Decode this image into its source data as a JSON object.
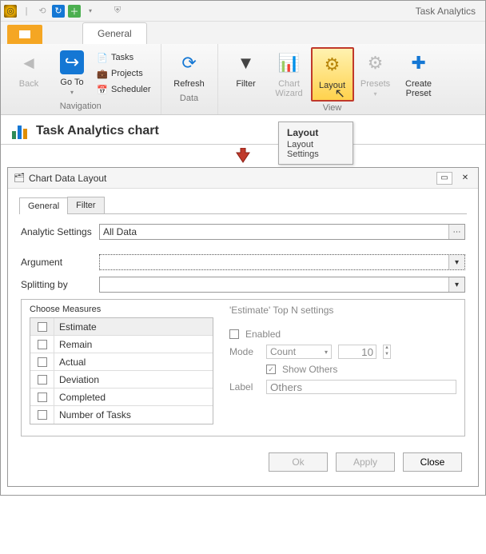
{
  "app": {
    "title": "Task Analytics"
  },
  "titlebar_icons": [
    "app",
    "sep",
    "sync",
    "plus",
    "dropdown",
    "shield"
  ],
  "ribbon_tab": "General",
  "ribbon": {
    "nav": {
      "label": "Navigation",
      "back": "Back",
      "goto": "Go To",
      "tasks": "Tasks",
      "projects": "Projects",
      "scheduler": "Scheduler"
    },
    "data": {
      "label": "Data",
      "refresh": "Refresh"
    },
    "view": {
      "label": "View",
      "filter": "Filter",
      "chart_wizard": "Chart\nWizard",
      "layout": "Layout",
      "presets": "Presets",
      "create_preset": "Create\nPreset"
    }
  },
  "tooltip": {
    "title": "Layout",
    "body": "Layout Settings"
  },
  "page_title": "Task Analytics chart",
  "dialog": {
    "title": "Chart Data Layout",
    "tabs": {
      "general": "General",
      "filter": "Filter"
    },
    "analytic_label": "Analytic Settings",
    "analytic_value": "All Data",
    "argument_label": "Argument",
    "argument_value": "",
    "splitting_label": "Splitting by",
    "splitting_value": "",
    "measures_title": "Choose Measures",
    "measures": [
      "Estimate",
      "Remain",
      "Actual",
      "Deviation",
      "Completed",
      "Number of Tasks"
    ],
    "topn": {
      "title": "'Estimate' Top N settings",
      "enabled": "Enabled",
      "mode_label": "Mode",
      "mode_value": "Count",
      "num_value": "10",
      "show_others": "Show Others",
      "label_label": "Label",
      "label_value": "Others"
    },
    "buttons": {
      "ok": "Ok",
      "apply": "Apply",
      "close": "Close"
    }
  }
}
